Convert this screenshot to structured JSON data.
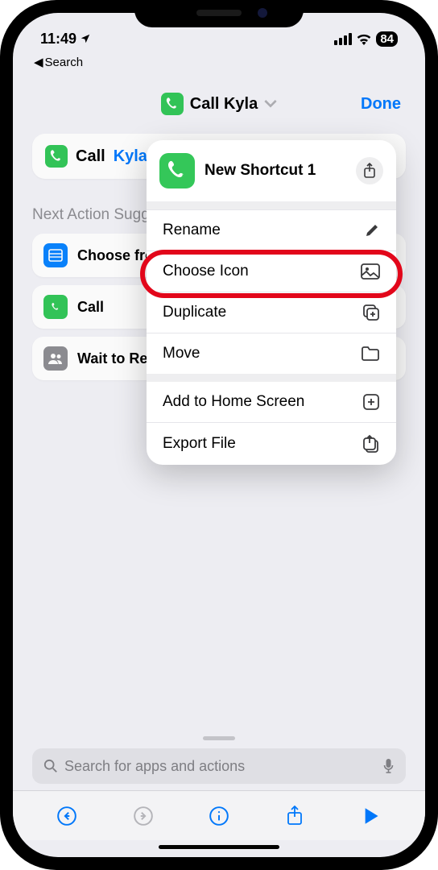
{
  "status": {
    "time": "11:49",
    "battery": "84"
  },
  "back_nav": "Search",
  "header": {
    "title": "Call Kyla",
    "done": "Done"
  },
  "action": {
    "verb": "Call",
    "name": "Kyla"
  },
  "suggestions_label": "Next Action Suggestions",
  "suggestions": [
    {
      "label": "Choose from Menu"
    },
    {
      "label": "Call"
    },
    {
      "label": "Wait to Return"
    }
  ],
  "search_placeholder": "Search for apps and actions",
  "popover": {
    "shortcut_name": "New Shortcut 1",
    "items": [
      {
        "label": "Rename",
        "icon": "pencil"
      },
      {
        "label": "Choose Icon",
        "icon": "photo"
      },
      {
        "label": "Duplicate",
        "icon": "duplicate"
      },
      {
        "label": "Move",
        "icon": "folder"
      },
      {
        "label": "Add to Home Screen",
        "icon": "plus-square"
      },
      {
        "label": "Export File",
        "icon": "export"
      }
    ]
  }
}
